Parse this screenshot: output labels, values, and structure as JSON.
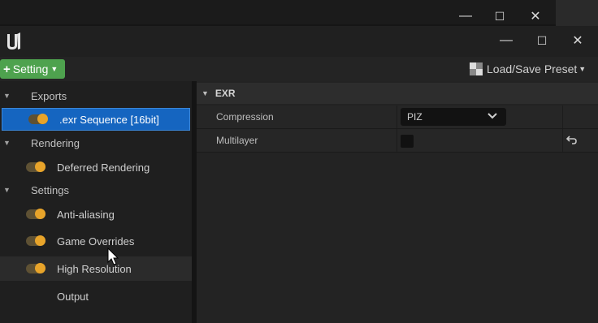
{
  "window": {
    "outer_controls": [
      "—",
      "☐",
      "✕"
    ],
    "inner_controls": [
      "—",
      "☐",
      "✕"
    ],
    "logo_icon": "unreal-logo-icon"
  },
  "toolbar": {
    "setting_plus": "+",
    "setting_label": "Setting",
    "setting_color": "#4ea24e",
    "preset_label": "Load/Save Preset"
  },
  "sidebar": {
    "sections": [
      {
        "label": "Exports",
        "items": [
          {
            "label": ".exr Sequence [16bit]",
            "selected": true,
            "toggle": true
          }
        ]
      },
      {
        "label": "Rendering",
        "items": [
          {
            "label": "Deferred Rendering",
            "toggle": true
          }
        ]
      },
      {
        "label": "Settings",
        "items": [
          {
            "label": "Anti-aliasing",
            "toggle": true
          },
          {
            "label": "Game Overrides",
            "toggle": true
          },
          {
            "label": "High Resolution",
            "toggle": true
          },
          {
            "label": "Output",
            "toggle": false
          }
        ]
      }
    ],
    "accent_selected": "#1565c0",
    "toggle_on_color": "#e8a42a"
  },
  "details": {
    "group_title": "EXR",
    "properties": [
      {
        "label": "Compression",
        "value": "PIZ",
        "control": "combo"
      },
      {
        "label": "Multilayer",
        "value": "unchecked",
        "control": "checkbox",
        "reset_icon": "reset-arrow-icon"
      }
    ]
  }
}
